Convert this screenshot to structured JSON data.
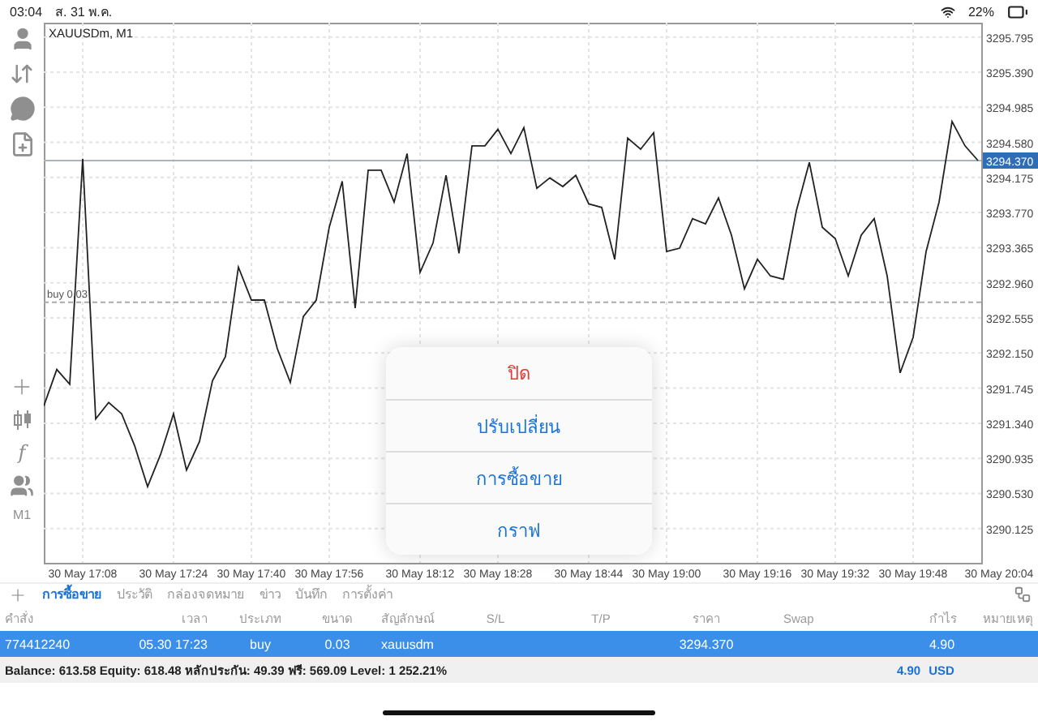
{
  "status_bar": {
    "time": "03:04",
    "date": "ส. 31 พ.ค.",
    "battery": "22%"
  },
  "toolbar": {
    "function_label": "f",
    "timeframe": "M1"
  },
  "chart": {
    "title": "XAUUSDm, M1",
    "chart_data": {
      "type": "line",
      "values": [
        3291.54,
        3291.96,
        3291.79,
        3294.39,
        3291.39,
        3291.58,
        3291.45,
        3291.08,
        3290.61,
        3290.98,
        3291.45,
        3290.8,
        3291.13,
        3291.83,
        3292.11,
        3293.14,
        3292.76,
        3292.76,
        3292.2,
        3291.81,
        3292.57,
        3292.76,
        3293.6,
        3294.13,
        3292.67,
        3294.26,
        3294.26,
        3293.89,
        3294.45,
        3293.08,
        3293.42,
        3294.2,
        3293.3,
        3294.54,
        3294.54,
        3294.73,
        3294.45,
        3294.75,
        3294.05,
        3294.17,
        3294.07,
        3294.2,
        3293.87,
        3293.83,
        3293.23,
        3294.63,
        3294.5,
        3294.69,
        3293.32,
        3293.36,
        3293.7,
        3293.64,
        3293.94,
        3293.51,
        3292.89,
        3293.23,
        3293.04,
        3293.0,
        3293.79,
        3294.35,
        3293.6,
        3293.47,
        3293.04,
        3293.51,
        3293.7,
        3293.04,
        3291.92,
        3292.33,
        3293.32,
        3293.89,
        3294.82,
        3294.54,
        3294.37,
        null,
        null
      ],
      "categories": [
        null,
        null,
        null,
        "30 May 17:08",
        null,
        null,
        null,
        null,
        null,
        null,
        "30 May 17:24",
        null,
        null,
        null,
        null,
        null,
        "30 May 17:40",
        null,
        null,
        null,
        null,
        null,
        "30 May 17:56",
        null,
        null,
        null,
        null,
        null,
        null,
        "30 May 18:12",
        null,
        null,
        null,
        null,
        null,
        "30 May 18:28",
        null,
        null,
        null,
        null,
        null,
        null,
        "30 May 18:44",
        null,
        null,
        null,
        null,
        null,
        "30 May 19:00",
        null,
        null,
        null,
        null,
        null,
        null,
        "30 May 19:16",
        null,
        null,
        null,
        null,
        null,
        "30 May 19:32",
        null,
        null,
        null,
        null,
        null,
        "30 May 19:48",
        null,
        null,
        null,
        null,
        null,
        null,
        "30 May 20:04"
      ],
      "grid": true,
      "ylim": [
        3289.73,
        3295.96
      ],
      "yticks": [
        {
          "value": 3295.795,
          "label": "3295.795"
        },
        {
          "value": 3295.39,
          "label": "3295.390"
        },
        {
          "value": 3294.985,
          "label": "3294.985"
        },
        {
          "value": 3294.58,
          "label": "3294.580"
        },
        {
          "value": 3294.175,
          "label": "3294.175"
        },
        {
          "value": 3293.77,
          "label": "3293.770"
        },
        {
          "value": 3293.365,
          "label": "3293.365"
        },
        {
          "value": 3292.96,
          "label": "3292.960"
        },
        {
          "value": 3292.555,
          "label": "3292.555"
        },
        {
          "value": 3292.15,
          "label": "3292.150"
        },
        {
          "value": 3291.745,
          "label": "3291.745"
        },
        {
          "value": 3291.34,
          "label": "3291.340"
        },
        {
          "value": 3290.935,
          "label": "3290.935"
        },
        {
          "value": 3290.53,
          "label": "3290.530"
        },
        {
          "value": 3290.125,
          "label": "3290.125"
        }
      ],
      "ref_lines": [
        {
          "axis": "y",
          "value": 3294.37,
          "label": "3294.370"
        },
        {
          "axis": "y",
          "value": 3292.736,
          "label": "buy 0.03"
        }
      ]
    }
  },
  "tabs": [
    {
      "label": "การซื้อขาย",
      "selected": true
    },
    {
      "label": "ประวัติ",
      "selected": false
    },
    {
      "label": "กล่องจดหมาย",
      "selected": false
    },
    {
      "label": "ข่าว",
      "selected": false
    },
    {
      "label": "บันทึก",
      "selected": false
    },
    {
      "label": "การตั้งค่า",
      "selected": false
    }
  ],
  "table": {
    "columns": [
      "คำสั่ง",
      "เวลา",
      "ประเภท",
      "ขนาด",
      "สัญลักษณ์",
      "S/L",
      "T/P",
      "ราคา",
      "Swap",
      "กำไร",
      "หมายเหตุ"
    ],
    "rows": [
      {
        "selected": true,
        "cells": [
          "774412240",
          "05.30 17:23",
          "buy",
          "0.03",
          "xauusdm",
          "",
          "",
          "3294.370",
          "",
          "4.90",
          ""
        ]
      }
    ]
  },
  "summary": {
    "text": "Balance: 613.58 Equity: 618.48 หลักประกัน: 49.39 ฟรี: 569.09 Level: 1 252.21%",
    "profit": "4.90",
    "currency": "USD"
  },
  "popup_menu": {
    "items": [
      {
        "label": "ปิด",
        "kind": "destructive"
      },
      {
        "label": "ปรับเปลี่ยน",
        "kind": "default"
      },
      {
        "label": "การซื้อขาย",
        "kind": "default"
      },
      {
        "label": "กราฟ",
        "kind": "default"
      }
    ]
  }
}
